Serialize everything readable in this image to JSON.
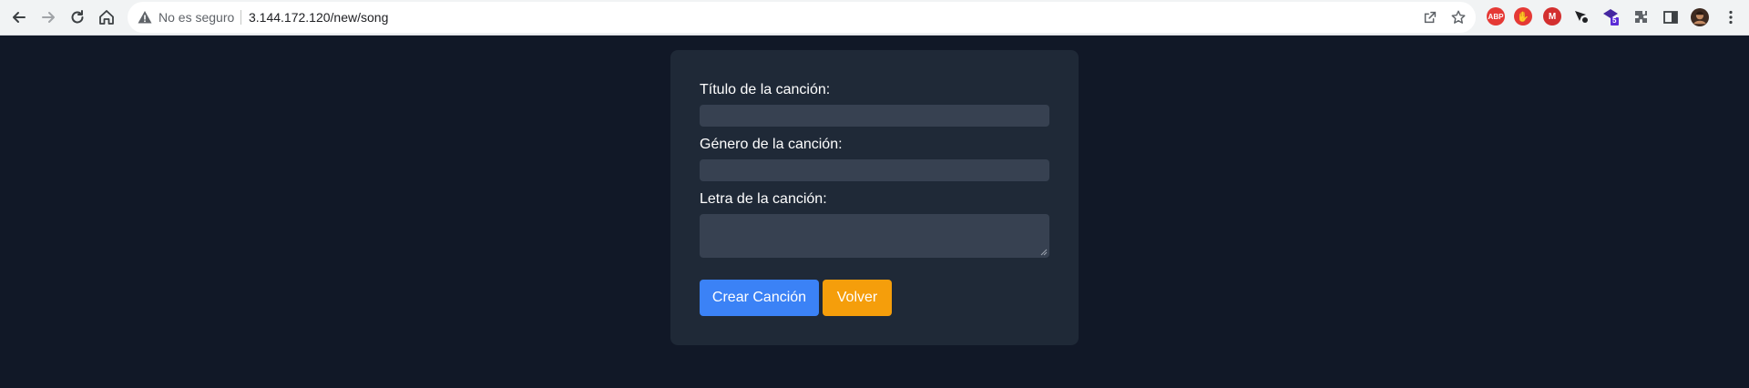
{
  "browser": {
    "address": {
      "security_label": "No es seguro",
      "url": "3.144.172.120/new/song"
    },
    "icons": [
      "back-icon",
      "forward-icon",
      "reload-icon",
      "home-icon",
      "warning-icon",
      "share-icon",
      "star-icon",
      "extensions-icon",
      "side-panel-icon",
      "profile-avatar",
      "menu-icon"
    ],
    "extensions": [
      {
        "name": "adblock-plus-extension",
        "text": "ABP",
        "color": "#e53935"
      },
      {
        "name": "stop-hand-extension",
        "text": "✋",
        "color": "#e53935"
      },
      {
        "name": "m-extension",
        "text": "M",
        "color": "#d32f2f"
      },
      {
        "name": "cursor-extension",
        "text": "",
        "color": "#202124"
      },
      {
        "name": "purple-badge-extension",
        "text": "5",
        "color": "#5b2bd6"
      }
    ],
    "colors": {
      "toolbar": "#f1f3f4",
      "omnibox": "#ffffff"
    }
  },
  "form": {
    "title_label": "Título de la canción:",
    "genre_label": "Género de la canción:",
    "lyrics_label": "Letra de la canción:",
    "title_value": "",
    "genre_value": "",
    "lyrics_value": "",
    "submit_label": "Crear Canción",
    "back_label": "Volver"
  },
  "colors": {
    "page_bg": "#111827",
    "card_bg": "#1f2937",
    "input_bg": "#374151",
    "submit": "#3b82f6",
    "back": "#f59e0b"
  }
}
